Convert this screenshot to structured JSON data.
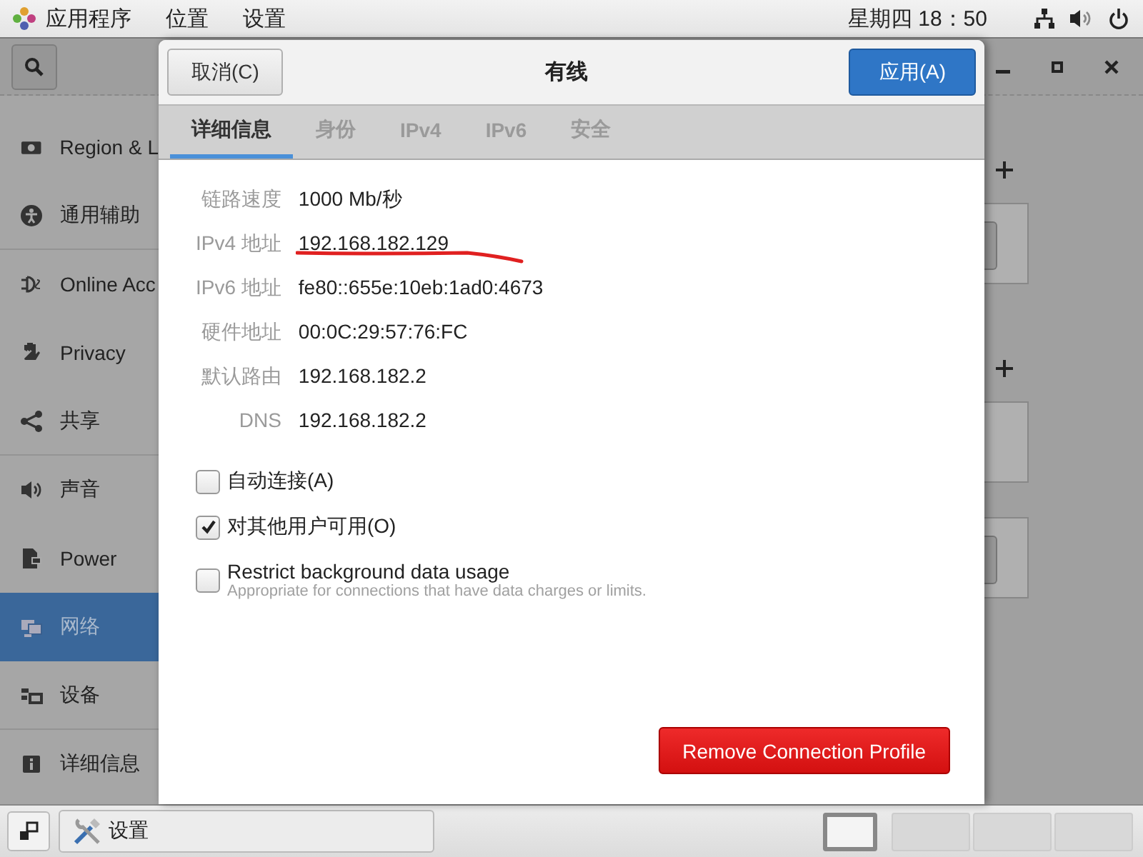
{
  "top_bar": {
    "menus": [
      "应用程序",
      "位置",
      "设置"
    ],
    "clock": "星期四 18：50"
  },
  "settings_window": {
    "sidebar": [
      {
        "label": "Region & L",
        "selected": false
      },
      {
        "label": "通用辅助",
        "selected": false
      },
      {
        "label": "Online Acc",
        "selected": false
      },
      {
        "label": "Privacy",
        "selected": false
      },
      {
        "label": "共享",
        "selected": false
      },
      {
        "label": "声音",
        "selected": false
      },
      {
        "label": "Power",
        "selected": false
      },
      {
        "label": "网络",
        "selected": true
      },
      {
        "label": "设备",
        "selected": false
      },
      {
        "label": "详细信息",
        "selected": false
      }
    ]
  },
  "dialog": {
    "title": "有线",
    "cancel_button": "取消(C)",
    "apply_button": "应用(A)",
    "tabs": [
      {
        "label": "详细信息",
        "selected": true
      },
      {
        "label": "身份",
        "selected": false
      },
      {
        "label": "IPv4",
        "selected": false
      },
      {
        "label": "IPv6",
        "selected": false
      },
      {
        "label": "安全",
        "selected": false
      }
    ],
    "details": [
      {
        "label": "链路速度",
        "value": "1000 Mb/秒"
      },
      {
        "label": "IPv4 地址",
        "value": "192.168.182.129"
      },
      {
        "label": "IPv6 地址",
        "value": "fe80::655e:10eb:1ad0:4673"
      },
      {
        "label": "硬件地址",
        "value": "00:0C:29:57:76:FC"
      },
      {
        "label": "默认路由",
        "value": "192.168.182.2"
      },
      {
        "label": "DNS",
        "value": "192.168.182.2"
      }
    ],
    "options": [
      {
        "label": "自动连接(A)",
        "checked": false
      },
      {
        "label": "对其他用户可用(O)",
        "checked": true
      },
      {
        "label": "Restrict background data usage",
        "description": "Appropriate for connections that have data charges or limits.",
        "checked": false
      }
    ],
    "remove_button": "Remove Connection Profile"
  },
  "taskbar": {
    "task": "设置",
    "workspaces": [
      {
        "selected": true
      },
      {
        "selected": false
      },
      {
        "selected": false
      },
      {
        "selected": false
      }
    ]
  }
}
